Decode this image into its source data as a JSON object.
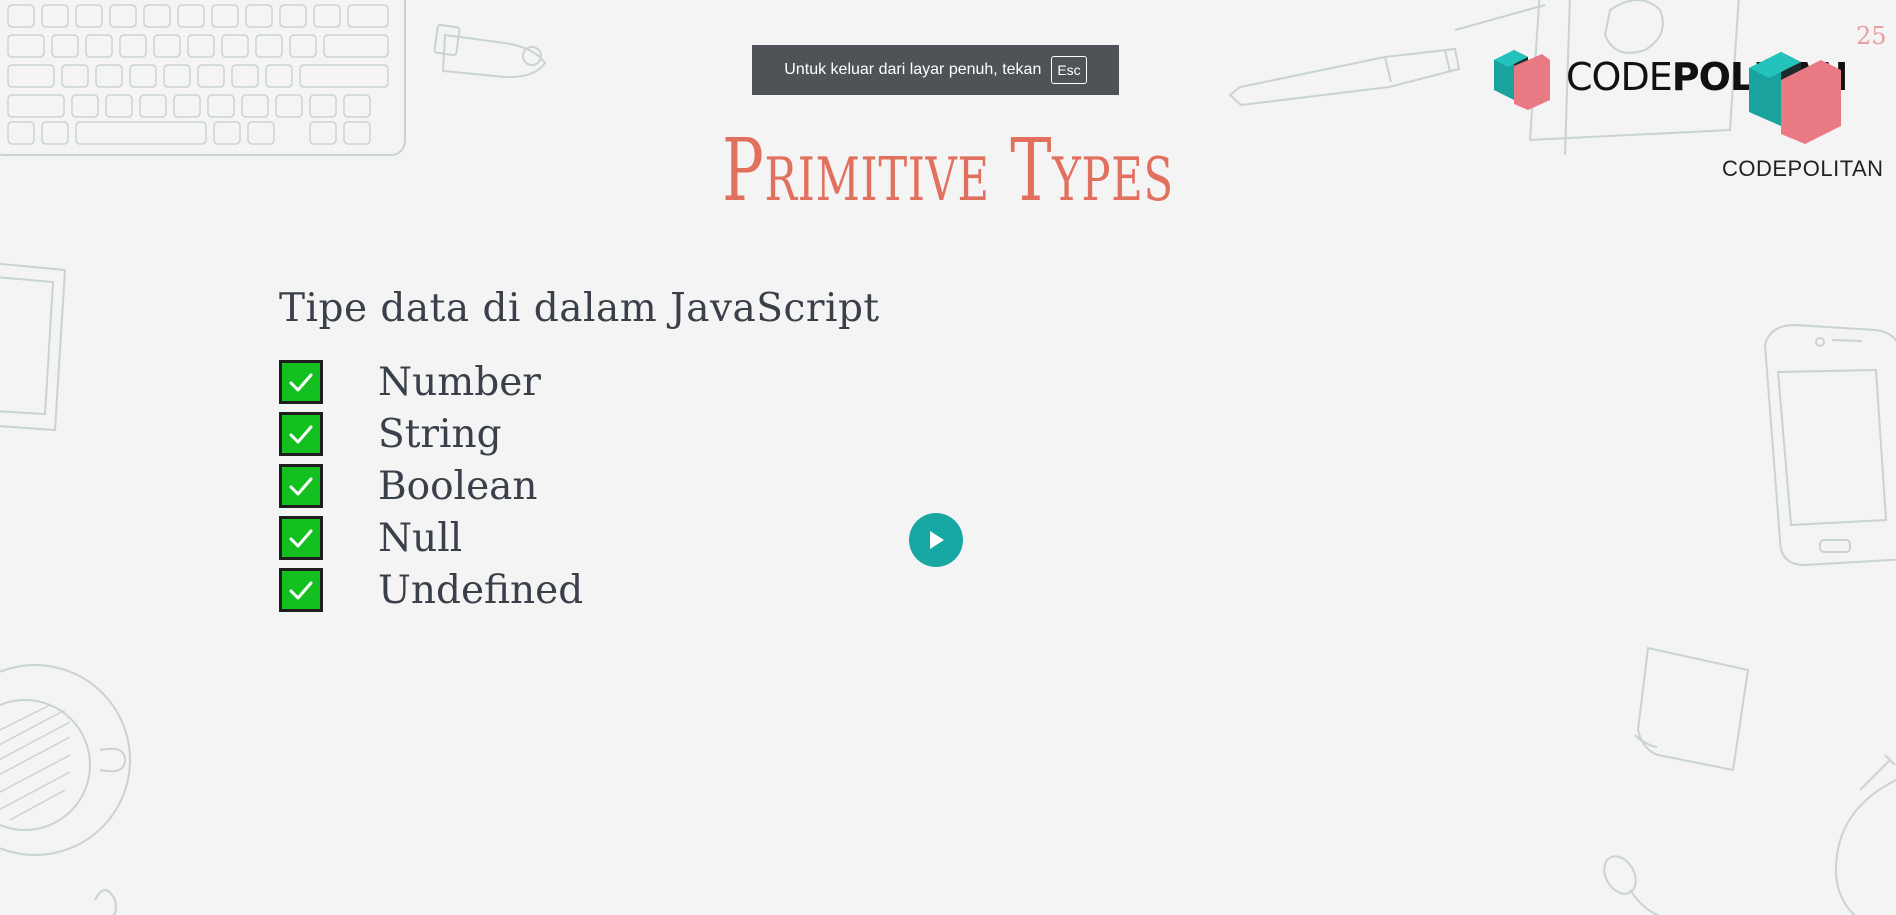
{
  "fullscreen_toast": {
    "message": "Untuk keluar dari layar penuh, tekan",
    "key": "Esc"
  },
  "slide": {
    "number": "25",
    "title": "Primitive Types",
    "subtitle": "Tipe data di dalam JavaScript",
    "items": [
      {
        "label": "Number",
        "checked": true
      },
      {
        "label": "String",
        "checked": true
      },
      {
        "label": "Boolean",
        "checked": true
      },
      {
        "label": "Null",
        "checked": true
      },
      {
        "label": "Undefined",
        "checked": true
      }
    ]
  },
  "brand": {
    "logo_light": "CODE",
    "logo_bold": "POLITAN",
    "caption": "CODEPOLITAN",
    "colors": {
      "teal": "#1aa39d",
      "pink": "#e97a84",
      "dark": "#1c2a2b"
    }
  },
  "icons": {
    "play": "play-icon",
    "check": "checkmark-icon"
  },
  "colors": {
    "title": "#e2705f",
    "text": "#3a4049",
    "check_green": "#14c01f",
    "play_teal": "#18a8a4",
    "toast_bg": "#4f5257"
  }
}
